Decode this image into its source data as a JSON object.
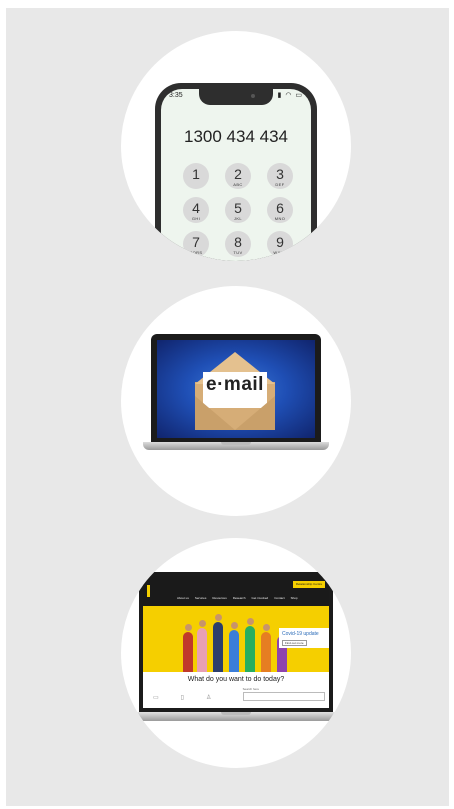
{
  "phone": {
    "status_time": "3:35",
    "status_icons": "▮ ◠ ▭",
    "number": "1300 434 434",
    "keys": [
      {
        "digit": "1",
        "letters": ""
      },
      {
        "digit": "2",
        "letters": "ABC"
      },
      {
        "digit": "3",
        "letters": "DEF"
      },
      {
        "digit": "4",
        "letters": "GHI"
      },
      {
        "digit": "5",
        "letters": "JKL"
      },
      {
        "digit": "6",
        "letters": "MNO"
      },
      {
        "digit": "7",
        "letters": "PQRS"
      },
      {
        "digit": "8",
        "letters": "TUV"
      },
      {
        "digit": "9",
        "letters": "WXYZ"
      }
    ]
  },
  "email": {
    "label": "e·mail"
  },
  "website": {
    "header_button": "Relationship Centre",
    "menu": [
      "About us",
      "Services",
      "Resources",
      "Research",
      "Get involved",
      "Contact",
      "Shop"
    ],
    "covid_title": "Covid-19 update",
    "covid_link": "Find out more",
    "heading": "What do you want to do today?",
    "search_label": "Search here"
  },
  "colors": {
    "panel": "#e8e8e8",
    "accent_yellow": "#f5cf00",
    "email_blue": "#1f4fb5"
  }
}
